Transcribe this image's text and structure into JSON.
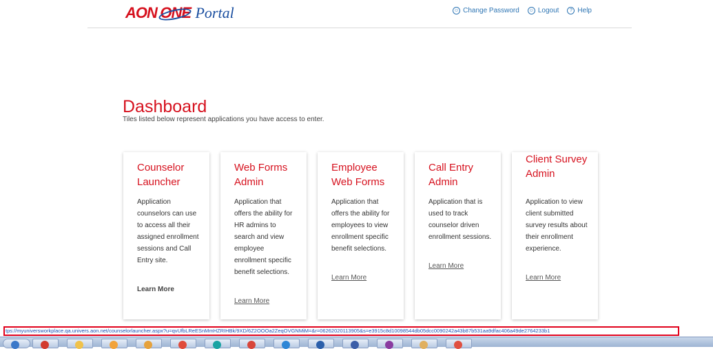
{
  "header": {
    "logo": {
      "aon": "AON",
      "one": "ONE",
      "portal": "Portal"
    },
    "links": [
      {
        "label": "Change Password",
        "icon": "user-icon"
      },
      {
        "label": "Logout",
        "icon": "user-icon"
      },
      {
        "label": "Help",
        "icon": "help-icon"
      }
    ]
  },
  "main": {
    "title": "Dashboard",
    "subtitle": "Tiles listed below represent applications you have access to enter."
  },
  "tiles": [
    {
      "title": "Counselor Launcher",
      "description": "Application counselors can use to access all their assigned enrollment sessions and Call Entry site.",
      "link": "Learn More"
    },
    {
      "title": "Web Forms Admin",
      "description": "Application that offers the ability for HR admins to search and view employee enrollment specific benefit selections.",
      "link": "Learn More"
    },
    {
      "title": "Employee Web Forms",
      "description": "Application that offers the ability for employees to view enrollment specific benefit selections.",
      "link": "Learn More"
    },
    {
      "title": "Call Entry Admin",
      "description": "Application that is used to track counselor driven enrollment sessions.",
      "link": "Learn More"
    },
    {
      "title": "Client Survey Admin",
      "description": "Application to view client submitted survey results about their enrollment experience.",
      "link": "Learn More"
    }
  ],
  "statusbar": {
    "url": "tps://myuniversworkplace.qa.univers.aon.net/counselorlauncher.aspx?u=qvUfbLReESnMmHZRIHBk/9XD/6Z2OOOa2ZeqOVGNMiM=&r=06262020113905&s=e3915c8d10098544db05dcc0090242a43b87b531aa9dfac406a49de2764233b1"
  },
  "colors": {
    "accent": "#d6111e",
    "link": "#2c74b3",
    "highlight": "#e0001b"
  }
}
